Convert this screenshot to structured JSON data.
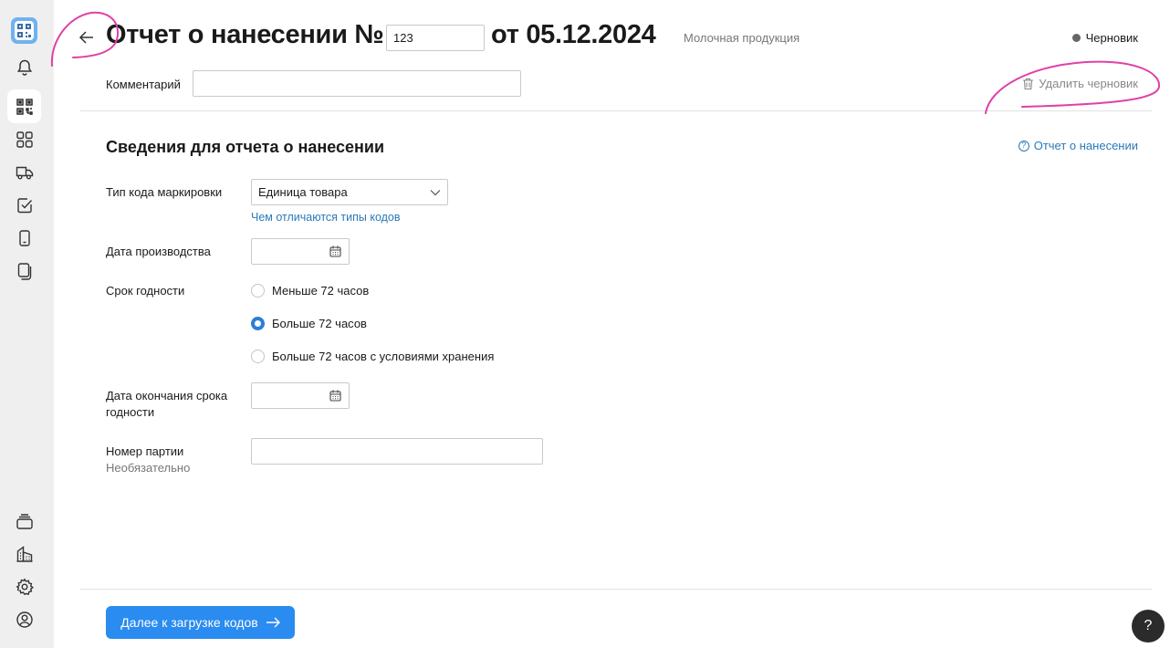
{
  "header": {
    "title_prefix": "Отчет о нанесении №",
    "report_number": "123",
    "title_date": "от 05.12.2024",
    "category": "Молочная продукция",
    "status": "Черновик",
    "status_color": "#666666"
  },
  "comment": {
    "label": "Комментарий",
    "value": ""
  },
  "actions": {
    "delete_draft": "Удалить черновик"
  },
  "section": {
    "title": "Сведения для отчета о нанесении",
    "help_link": "Отчет о нанесении"
  },
  "form": {
    "code_type": {
      "label": "Тип кода маркировки",
      "selected": "Единица товара",
      "hint_link": "Чем отличаются типы кодов"
    },
    "production_date": {
      "label": "Дата производства",
      "value": ""
    },
    "shelf_life": {
      "label": "Срок годности",
      "options": [
        {
          "label": "Меньше 72 часов",
          "checked": false
        },
        {
          "label": "Больше 72 часов",
          "checked": true
        },
        {
          "label": "Больше 72 часов с условиями хранения",
          "checked": false
        }
      ]
    },
    "expiry_date": {
      "label": "Дата окончания срока годности",
      "value": ""
    },
    "batch_number": {
      "label": "Номер партии",
      "sublabel": "Необязательно",
      "value": ""
    }
  },
  "footer": {
    "next_button": "Далее к загрузке кодов",
    "help_fab": "?"
  },
  "sidebar": {
    "items": [
      {
        "icon": "app-logo-icon"
      },
      {
        "icon": "bell-icon"
      },
      {
        "icon": "qr-code-icon",
        "active": true
      },
      {
        "icon": "grid-icon"
      },
      {
        "icon": "truck-icon"
      },
      {
        "icon": "checkbox-icon"
      },
      {
        "icon": "phone-icon"
      },
      {
        "icon": "documents-icon"
      },
      {
        "icon": "stack-icon"
      },
      {
        "icon": "building-icon"
      },
      {
        "icon": "gear-icon"
      },
      {
        "icon": "user-icon"
      }
    ]
  },
  "colors": {
    "accent": "#2a8bf0",
    "link": "#2a7ab8",
    "annotation": "#e040a8"
  }
}
